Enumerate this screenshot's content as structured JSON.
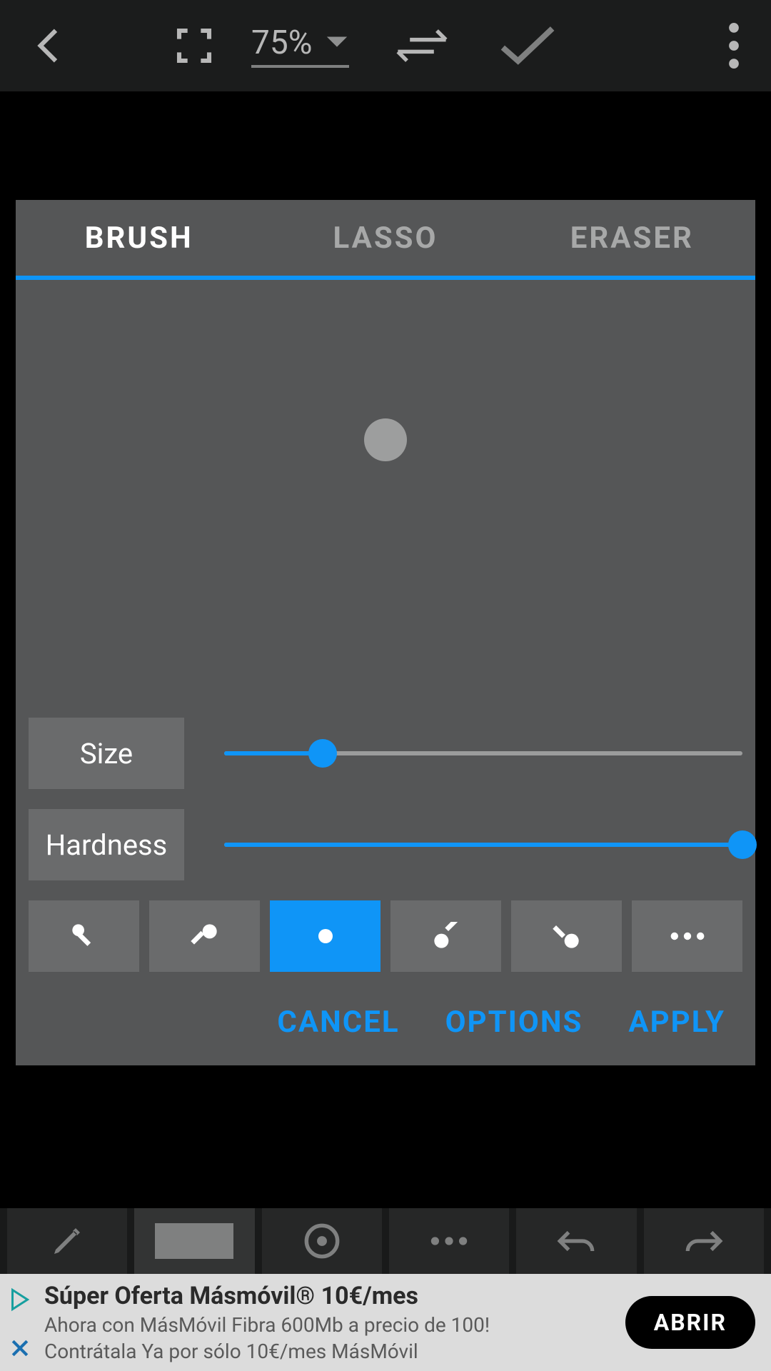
{
  "topbar": {
    "zoom_pct": "75%"
  },
  "tabs": [
    "BRUSH",
    "LASSO",
    "ERASER"
  ],
  "active_tab": 0,
  "sliders": {
    "size": {
      "label": "Size",
      "value_pct": 19
    },
    "hardness": {
      "label": "Hardness",
      "value_pct": 100
    }
  },
  "presets": {
    "active_index": 2
  },
  "actions": {
    "cancel": "CANCEL",
    "options": "OPTIONS",
    "apply": "APPLY"
  },
  "ad": {
    "title": "Súper Oferta Másmóvil® 10€/mes",
    "line1": "Ahora con MásMóvil Fibra 600Mb a precio de 100!",
    "line2": "Contrátala Ya por sólo 10€/mes MásMóvil",
    "cta": "ABRIR"
  },
  "colors": {
    "accent": "#0f95f7"
  }
}
